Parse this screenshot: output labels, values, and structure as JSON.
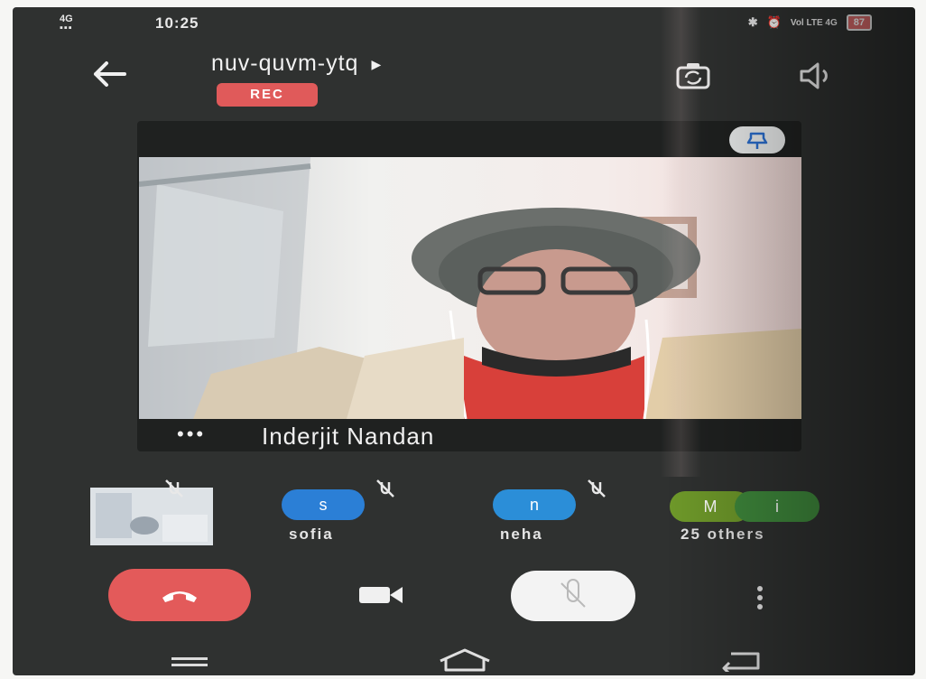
{
  "status_bar": {
    "signal": "4G",
    "time": "10:25",
    "right_text": "Vol LTE 4G",
    "battery": "87"
  },
  "header": {
    "meeting_code": "nuv-quvm-ytq",
    "recording_badge": "REC",
    "icons": [
      "back-arrow-icon",
      "switch-camera-icon",
      "speaker-icon"
    ]
  },
  "main_video": {
    "participant_name": "Inderjit Nandan",
    "more_dots": "•••",
    "icons": [
      "pin-icon"
    ]
  },
  "participants": [
    {
      "initial": "s",
      "name": "sofia",
      "color": "#2b7fd6",
      "muted": true
    },
    {
      "initial": "n",
      "name": "neha",
      "color": "#2b8ed8",
      "muted": true
    },
    {
      "initials": [
        "M",
        "i"
      ],
      "label": "25 others",
      "colors": [
        "#6f9a2a",
        "#3f8a3c"
      ]
    }
  ],
  "controls": {
    "icons": [
      "end-call-icon",
      "camera-icon",
      "mic-off-icon",
      "more-vert-icon"
    ],
    "colors": {
      "end_call": "#e35a5a",
      "mic": "#f3f3f3"
    }
  },
  "nav": {
    "icons": [
      "recent-apps-icon",
      "home-icon",
      "nav-back-icon"
    ]
  }
}
